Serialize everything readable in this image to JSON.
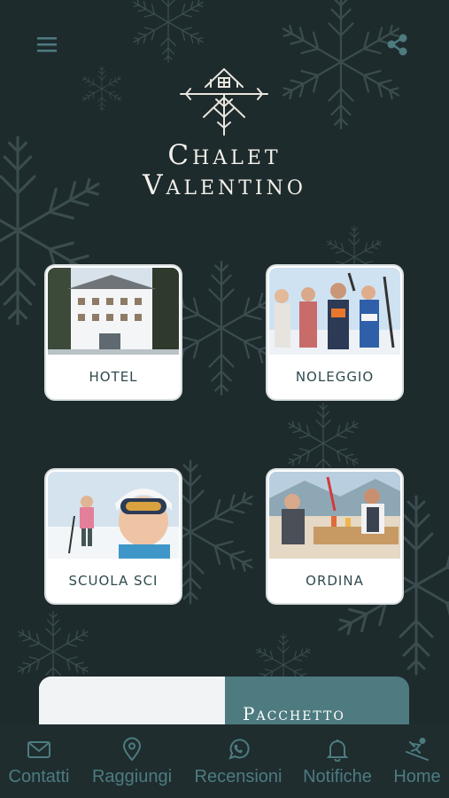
{
  "app": {
    "brand_line1": "Chalet",
    "brand_line2": "Valentino"
  },
  "header": {
    "menu_icon": "hamburger-menu-icon",
    "share_icon": "share-icon",
    "logo_icon": "chalet-snowflake-logo"
  },
  "cards": [
    {
      "label": "HOTEL",
      "image": "hotel-building-photo"
    },
    {
      "label": "NOLEGGIO",
      "image": "skiers-group-photo"
    },
    {
      "label": "SCUOLA SCI",
      "image": "ski-school-children-photo"
    },
    {
      "label": "ORDINA",
      "image": "terrace-table-photo"
    }
  ],
  "package": {
    "title": "Pacchetto"
  },
  "tabs": [
    {
      "label": "Contatti",
      "icon": "mail-icon"
    },
    {
      "label": "Raggiungi",
      "icon": "location-pin-icon"
    },
    {
      "label": "Recensioni",
      "icon": "whatsapp-icon"
    },
    {
      "label": "Notifiche",
      "icon": "bell-icon"
    },
    {
      "label": "Home",
      "icon": "skier-icon"
    }
  ],
  "colors": {
    "background": "#1e2b2d",
    "accent": "#4d7b80",
    "card_text": "#2f4a4e",
    "brand_text": "#f3f1ea"
  }
}
